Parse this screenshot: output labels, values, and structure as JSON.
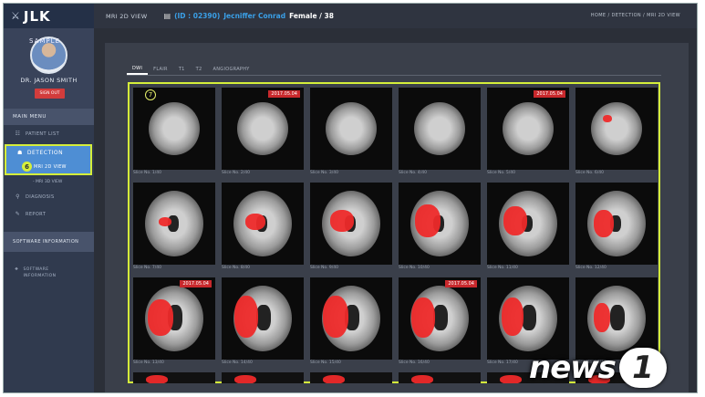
{
  "sidebar": {
    "logo": "JLK",
    "sample_watermark": "SAMPLE",
    "doctor": "DR. JASON SMITH",
    "signout": "SIGN OUT",
    "menu_header": "MAIN MENU",
    "patient_list": "PATIENT LIST",
    "detection": "DETECTION",
    "badge_detection": "6",
    "mri_2d": "MRI 2D VIEW",
    "mri_3d": "- MRI 3D VIEW",
    "diagnosis": "DIAGNOSIS",
    "report": "REPORT",
    "software_header": "SOFTWARE INFORMATION",
    "software_item": "SOFTWARE INFORMATION"
  },
  "header": {
    "page_title": "MRI 2D VIEW",
    "patient_id": "(ID : 02390)",
    "patient_name": "Jecniffer Conrad",
    "patient_meta": "Female / 38",
    "breadcrumb": "HOME / DETECTION / MRI 2D VIEW"
  },
  "tabs": [
    "DWI",
    "FLAIR",
    "T1",
    "T2",
    "ANGIOGRAPHY"
  ],
  "grid_badge": "7",
  "slices": [
    {
      "caption": "Slice No. 1/40",
      "date": ""
    },
    {
      "caption": "Slice No. 2/40",
      "date": "2017.05.04"
    },
    {
      "caption": "Slice No. 3/40",
      "date": ""
    },
    {
      "caption": "Slice No. 4/40",
      "date": ""
    },
    {
      "caption": "Slice No. 5/40",
      "date": "2017.05.04"
    },
    {
      "caption": "Slice No. 6/40",
      "date": ""
    },
    {
      "caption": "Slice No. 7/40",
      "date": ""
    },
    {
      "caption": "Slice No. 8/40",
      "date": ""
    },
    {
      "caption": "Slice No. 9/40",
      "date": ""
    },
    {
      "caption": "Slice No. 10/40",
      "date": ""
    },
    {
      "caption": "Slice No. 11/40",
      "date": ""
    },
    {
      "caption": "Slice No. 12/40",
      "date": ""
    },
    {
      "caption": "Slice No. 13/40",
      "date": "2017.05.04"
    },
    {
      "caption": "Slice No. 14/40",
      "date": ""
    },
    {
      "caption": "Slice No. 15/40",
      "date": ""
    },
    {
      "caption": "Slice No. 16/40",
      "date": "2017.05.04"
    },
    {
      "caption": "Slice No. 17/40",
      "date": ""
    },
    {
      "caption": "Slice No. 18/40",
      "date": ""
    }
  ],
  "watermark": {
    "text": "news",
    "number": "1"
  }
}
